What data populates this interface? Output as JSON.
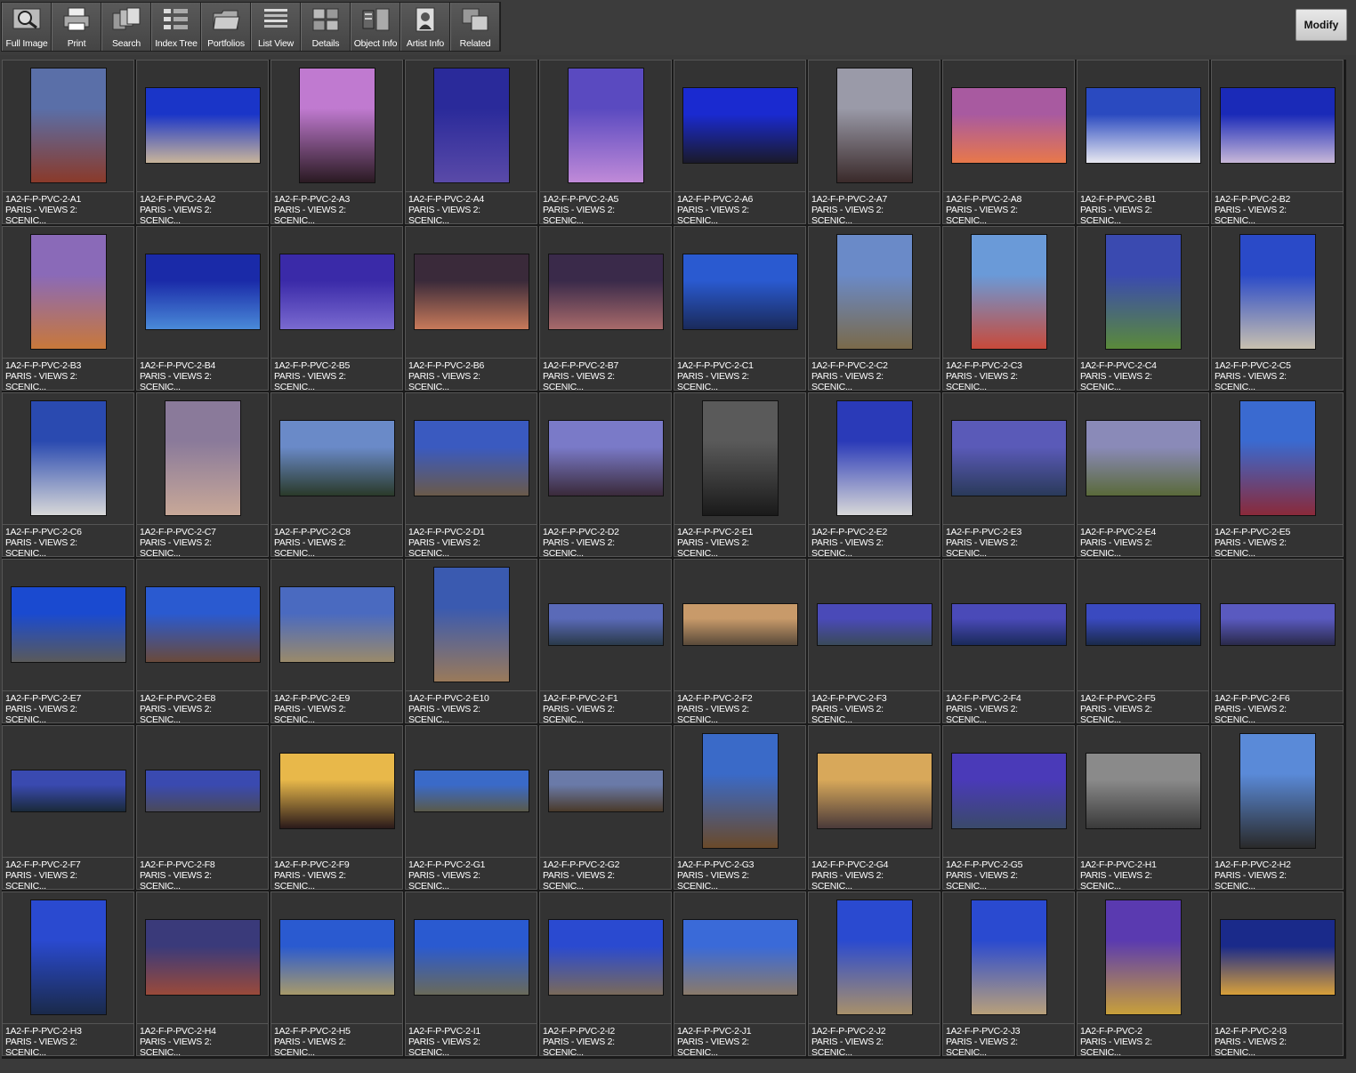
{
  "toolbar": {
    "buttons": [
      {
        "label": "Full Image",
        "icon": "magnifier-icon"
      },
      {
        "label": "Print",
        "icon": "printer-icon"
      },
      {
        "label": "Search",
        "icon": "search-records-icon"
      },
      {
        "label": "Index Tree",
        "icon": "index-tree-icon"
      },
      {
        "label": "Portfolios",
        "icon": "folder-icon"
      },
      {
        "label": "List View",
        "icon": "list-view-icon"
      },
      {
        "label": "Details",
        "icon": "details-grid-icon"
      },
      {
        "label": "Object Info",
        "icon": "object-info-icon"
      },
      {
        "label": "Artist  Info",
        "icon": "artist-portrait-icon"
      },
      {
        "label": "Related",
        "icon": "related-stack-icon"
      }
    ],
    "modify_label": "Modify"
  },
  "thumbnails": [
    {
      "id": "1A2-F-P-PVC-2-A1",
      "line2": "PARIS - VIEWS 2:",
      "line3": "SCENIC...",
      "orient": "portrait",
      "c1": "#5a6fa8",
      "c2": "#8a3a2a"
    },
    {
      "id": "1A2-F-P-PVC-2-A2",
      "line2": "PARIS - VIEWS 2:",
      "line3": "SCENIC...",
      "orient": "landscape",
      "c1": "#1a35c8",
      "c2": "#c9b59a"
    },
    {
      "id": "1A2-F-P-PVC-2-A3",
      "line2": "PARIS - VIEWS 2:",
      "line3": "SCENIC...",
      "orient": "portrait",
      "c1": "#c07ad0",
      "c2": "#2a1a22"
    },
    {
      "id": "1A2-F-P-PVC-2-A4",
      "line2": "PARIS - VIEWS 2:",
      "line3": "SCENIC...",
      "orient": "portrait",
      "c1": "#2a2a9a",
      "c2": "#5a4aa8"
    },
    {
      "id": "1A2-F-P-PVC-2-A5",
      "line2": "PARIS - VIEWS 2:",
      "line3": "SCENIC...",
      "orient": "portrait",
      "c1": "#5a4ac0",
      "c2": "#c08ad8"
    },
    {
      "id": "1A2-F-P-PVC-2-A6",
      "line2": "PARIS - VIEWS 2:",
      "line3": "SCENIC...",
      "orient": "landscape",
      "c1": "#1a2ad0",
      "c2": "#1a1a2a"
    },
    {
      "id": "1A2-F-P-PVC-2-A7",
      "line2": "PARIS - VIEWS 2:",
      "line3": "SCENIC...",
      "orient": "portrait",
      "c1": "#9a9aa8",
      "c2": "#3a2a2a"
    },
    {
      "id": "1A2-F-P-PVC-2-A8",
      "line2": "PARIS - VIEWS 2:",
      "line3": "SCENIC...",
      "orient": "landscape",
      "c1": "#a85aa0",
      "c2": "#e8784a"
    },
    {
      "id": "1A2-F-P-PVC-2-B1",
      "line2": "PARIS - VIEWS 2:",
      "line3": "SCENIC...",
      "orient": "landscape",
      "c1": "#2a4ac0",
      "c2": "#e8e8f0"
    },
    {
      "id": "1A2-F-P-PVC-2-B2",
      "line2": "PARIS - VIEWS 2:",
      "line3": "SCENIC...",
      "orient": "landscape",
      "c1": "#1a2ab8",
      "c2": "#c8b8d8"
    },
    {
      "id": "1A2-F-P-PVC-2-B3",
      "line2": "PARIS - VIEWS 2:",
      "line3": "SCENIC...",
      "orient": "portrait",
      "c1": "#8a6ab8",
      "c2": "#c8783a"
    },
    {
      "id": "1A2-F-P-PVC-2-B4",
      "line2": "PARIS - VIEWS 2:",
      "line3": "SCENIC...",
      "orient": "landscape",
      "c1": "#1a2aa8",
      "c2": "#4a8ad8"
    },
    {
      "id": "1A2-F-P-PVC-2-B5",
      "line2": "PARIS - VIEWS 2:",
      "line3": "SCENIC...",
      "orient": "landscape",
      "c1": "#3a2aa8",
      "c2": "#7a6ad0"
    },
    {
      "id": "1A2-F-P-PVC-2-B6",
      "line2": "PARIS - VIEWS 2:",
      "line3": "SCENIC...",
      "orient": "landscape",
      "c1": "#3a2a3a",
      "c2": "#c87a5a"
    },
    {
      "id": "1A2-F-P-PVC-2-B7",
      "line2": "PARIS - VIEWS 2:",
      "line3": "SCENIC...",
      "orient": "landscape",
      "c1": "#3a2a4a",
      "c2": "#a86a6a"
    },
    {
      "id": "1A2-F-P-PVC-2-C1",
      "line2": "PARIS - VIEWS 2:",
      "line3": "SCENIC...",
      "orient": "landscape",
      "c1": "#2a5ad0",
      "c2": "#1a2a5a"
    },
    {
      "id": "1A2-F-P-PVC-2-C2",
      "line2": "PARIS - VIEWS 2:",
      "line3": "SCENIC...",
      "orient": "portrait",
      "c1": "#6a8ac8",
      "c2": "#7a6a4a"
    },
    {
      "id": "1A2-F-P-PVC-2-C3",
      "line2": "PARIS - VIEWS 2:",
      "line3": "SCENIC...",
      "orient": "portrait",
      "c1": "#6a9ad8",
      "c2": "#c84a3a"
    },
    {
      "id": "1A2-F-P-PVC-2-C4",
      "line2": "PARIS - VIEWS 2:",
      "line3": "SCENIC...",
      "orient": "portrait",
      "c1": "#3a4ab0",
      "c2": "#5a8a3a"
    },
    {
      "id": "1A2-F-P-PVC-2-C5",
      "line2": "PARIS - VIEWS 2:",
      "line3": "SCENIC...",
      "orient": "portrait",
      "c1": "#2a4ac8",
      "c2": "#c8c0b0"
    },
    {
      "id": "1A2-F-P-PVC-2-C6",
      "line2": "PARIS - VIEWS 2:",
      "line3": "SCENIC...",
      "orient": "portrait",
      "c1": "#2a4ab0",
      "c2": "#d8d8d8"
    },
    {
      "id": "1A2-F-P-PVC-2-C7",
      "line2": "PARIS - VIEWS 2:",
      "line3": "SCENIC...",
      "orient": "portrait",
      "c1": "#8a7a9a",
      "c2": "#c8a898"
    },
    {
      "id": "1A2-F-P-PVC-2-C8",
      "line2": "PARIS - VIEWS 2:",
      "line3": "SCENIC...",
      "orient": "landscape",
      "c1": "#6a8ac8",
      "c2": "#2a3a2a"
    },
    {
      "id": "1A2-F-P-PVC-2-D1",
      "line2": "PARIS - VIEWS 2:",
      "line3": "SCENIC...",
      "orient": "landscape",
      "c1": "#3a5ac0",
      "c2": "#6a5a4a"
    },
    {
      "id": "1A2-F-P-PVC-2-D2",
      "line2": "PARIS - VIEWS 2:",
      "line3": "SCENIC...",
      "orient": "landscape",
      "c1": "#7a7ac8",
      "c2": "#3a2a3a"
    },
    {
      "id": "1A2-F-P-PVC-2-E1",
      "line2": "PARIS - VIEWS 2:",
      "line3": "SCENIC...",
      "orient": "portrait",
      "c1": "#5a5a5a",
      "c2": "#1a1a1a"
    },
    {
      "id": "1A2-F-P-PVC-2-E2",
      "line2": "PARIS - VIEWS 2:",
      "line3": "SCENIC...",
      "orient": "portrait",
      "c1": "#2a3ab8",
      "c2": "#d8d8d8"
    },
    {
      "id": "1A2-F-P-PVC-2-E3",
      "line2": "PARIS - VIEWS 2:",
      "line3": "SCENIC...",
      "orient": "landscape",
      "c1": "#5a5ab8",
      "c2": "#2a3a5a"
    },
    {
      "id": "1A2-F-P-PVC-2-E4",
      "line2": "PARIS - VIEWS 2:",
      "line3": "SCENIC...",
      "orient": "landscape",
      "c1": "#8a8ab8",
      "c2": "#5a6a3a"
    },
    {
      "id": "1A2-F-P-PVC-2-E5",
      "line2": "PARIS - VIEWS 2:",
      "line3": "SCENIC...",
      "orient": "portrait",
      "c1": "#3a6ad0",
      "c2": "#8a2a3a"
    },
    {
      "id": "1A2-F-P-PVC-2-E7",
      "line2": "PARIS - VIEWS 2:",
      "line3": "SCENIC...",
      "orient": "landscape",
      "c1": "#1a4ad0",
      "c2": "#5a5a5a"
    },
    {
      "id": "1A2-F-P-PVC-2-E8",
      "line2": "PARIS - VIEWS 2:",
      "line3": "SCENIC...",
      "orient": "landscape",
      "c1": "#2a5ad0",
      "c2": "#6a4a3a"
    },
    {
      "id": "1A2-F-P-PVC-2-E9",
      "line2": "PARIS - VIEWS 2:",
      "line3": "SCENIC...",
      "orient": "landscape",
      "c1": "#4a6ac0",
      "c2": "#9a8a6a"
    },
    {
      "id": "1A2-F-P-PVC-2-E10",
      "line2": "PARIS - VIEWS 2:",
      "line3": "SCENIC...",
      "orient": "portrait",
      "c1": "#3a5ab0",
      "c2": "#9a7a5a"
    },
    {
      "id": "1A2-F-P-PVC-2-F1",
      "line2": "PARIS - VIEWS 2:",
      "line3": "SCENIC...",
      "orient": "wide",
      "c1": "#5a6ab8",
      "c2": "#2a3a4a"
    },
    {
      "id": "1A2-F-P-PVC-2-F2",
      "line2": "PARIS - VIEWS 2:",
      "line3": "SCENIC...",
      "orient": "wide",
      "c1": "#c89a6a",
      "c2": "#5a4a3a"
    },
    {
      "id": "1A2-F-P-PVC-2-F3",
      "line2": "PARIS - VIEWS 2:",
      "line3": "SCENIC...",
      "orient": "wide",
      "c1": "#4a4ab8",
      "c2": "#3a4a5a"
    },
    {
      "id": "1A2-F-P-PVC-2-F4",
      "line2": "PARIS - VIEWS 2:",
      "line3": "SCENIC...",
      "orient": "wide",
      "c1": "#4a4ab8",
      "c2": "#1a2a5a"
    },
    {
      "id": "1A2-F-P-PVC-2-F5",
      "line2": "PARIS - VIEWS 2:",
      "line3": "SCENIC...",
      "orient": "wide",
      "c1": "#3a4ac0",
      "c2": "#1a2a4a"
    },
    {
      "id": "1A2-F-P-PVC-2-F6",
      "line2": "PARIS - VIEWS 2:",
      "line3": "SCENIC...",
      "orient": "wide",
      "c1": "#5a5ac0",
      "c2": "#2a2a4a"
    },
    {
      "id": "1A2-F-P-PVC-2-F7",
      "line2": "PARIS - VIEWS 2:",
      "line3": "SCENIC...",
      "orient": "wide",
      "c1": "#3a4ab0",
      "c2": "#1a2a3a"
    },
    {
      "id": "1A2-F-P-PVC-2-F8",
      "line2": "PARIS - VIEWS 2:",
      "line3": "SCENIC...",
      "orient": "wide",
      "c1": "#3a4ab0",
      "c2": "#4a4a5a"
    },
    {
      "id": "1A2-F-P-PVC-2-F9",
      "line2": "PARIS - VIEWS 2:",
      "line3": "SCENIC...",
      "orient": "landscape",
      "c1": "#e8b84a",
      "c2": "#2a1a1a"
    },
    {
      "id": "1A2-F-P-PVC-2-G1",
      "line2": "PARIS - VIEWS 2:",
      "line3": "SCENIC...",
      "orient": "wide",
      "c1": "#3a6ac8",
      "c2": "#5a5a4a"
    },
    {
      "id": "1A2-F-P-PVC-2-G2",
      "line2": "PARIS - VIEWS 2:",
      "line3": "SCENIC...",
      "orient": "wide",
      "c1": "#6a7aa8",
      "c2": "#4a3a2a"
    },
    {
      "id": "1A2-F-P-PVC-2-G3",
      "line2": "PARIS - VIEWS 2:",
      "line3": "SCENIC...",
      "orient": "portrait",
      "c1": "#3a6ac8",
      "c2": "#6a4a2a"
    },
    {
      "id": "1A2-F-P-PVC-2-G4",
      "line2": "PARIS - VIEWS 2:",
      "line3": "SCENIC...",
      "orient": "landscape",
      "c1": "#d8a85a",
      "c2": "#4a3a3a"
    },
    {
      "id": "1A2-F-P-PVC-2-G5",
      "line2": "PARIS - VIEWS 2:",
      "line3": "SCENIC...",
      "orient": "landscape",
      "c1": "#4a3ab8",
      "c2": "#3a4a6a"
    },
    {
      "id": "1A2-F-P-PVC-2-H1",
      "line2": "PARIS - VIEWS 2:",
      "line3": "SCENIC...",
      "orient": "landscape",
      "c1": "#8a8a8a",
      "c2": "#3a3a3a"
    },
    {
      "id": "1A2-F-P-PVC-2-H2",
      "line2": "PARIS - VIEWS 2:",
      "line3": "SCENIC...",
      "orient": "portrait",
      "c1": "#5a8ad8",
      "c2": "#2a2a2a"
    },
    {
      "id": "1A2-F-P-PVC-2-H3",
      "line2": "PARIS - VIEWS 2:",
      "line3": "SCENIC...",
      "orient": "portrait",
      "c1": "#2a4ad0",
      "c2": "#1a2a4a"
    },
    {
      "id": "1A2-F-P-PVC-2-H4",
      "line2": "PARIS - VIEWS 2:",
      "line3": "SCENIC...",
      "orient": "landscape",
      "c1": "#3a3a7a",
      "c2": "#9a4a3a"
    },
    {
      "id": "1A2-F-P-PVC-2-H5",
      "line2": "PARIS - VIEWS 2:",
      "line3": "SCENIC...",
      "orient": "landscape",
      "c1": "#2a5ad0",
      "c2": "#a89a6a"
    },
    {
      "id": "1A2-F-P-PVC-2-I1",
      "line2": "PARIS - VIEWS 2:",
      "line3": "SCENIC...",
      "orient": "landscape",
      "c1": "#2a5ad0",
      "c2": "#6a6a5a"
    },
    {
      "id": "1A2-F-P-PVC-2-I2",
      "line2": "PARIS - VIEWS 2:",
      "line3": "SCENIC...",
      "orient": "landscape",
      "c1": "#2a4ad0",
      "c2": "#7a6a5a"
    },
    {
      "id": "1A2-F-P-PVC-2-J1",
      "line2": "PARIS - VIEWS 2:",
      "line3": "SCENIC...",
      "orient": "landscape",
      "c1": "#3a6ad8",
      "c2": "#8a7a6a"
    },
    {
      "id": "1A2-F-P-PVC-2-J2",
      "line2": "PARIS - VIEWS 2:",
      "line3": "SCENIC...",
      "orient": "portrait",
      "c1": "#2a4ad0",
      "c2": "#a8906a"
    },
    {
      "id": "1A2-F-P-PVC-2-J3",
      "line2": "PARIS - VIEWS 2:",
      "line3": "SCENIC...",
      "orient": "portrait",
      "c1": "#2a4ad0",
      "c2": "#b8a07a"
    },
    {
      "id": "1A2-F-P-PVC-2",
      "line2": "PARIS - VIEWS 2:",
      "line3": "SCENIC...",
      "orient": "portrait",
      "c1": "#5a3ab0",
      "c2": "#c8a03a"
    },
    {
      "id": "1A2-F-P-PVC-2-I3",
      "line2": "PARIS - VIEWS 2:",
      "line3": "SCENIC...",
      "orient": "landscape",
      "c1": "#1a2a8a",
      "c2": "#d8a03a"
    }
  ]
}
